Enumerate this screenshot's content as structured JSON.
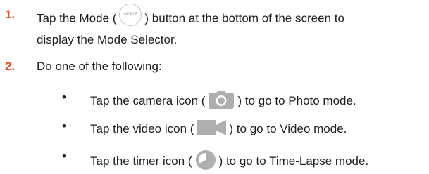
{
  "steps": [
    {
      "number": "1.",
      "line1_before": "Tap the Mode (",
      "line1_after": ") button at the bottom of the screen to",
      "line2": "display the Mode Selector.",
      "icon_label": "MODE"
    },
    {
      "number": "2.",
      "text": "Do one of the following:"
    }
  ],
  "options": [
    {
      "bullet": "•",
      "before": "Tap the camera icon (",
      "after": ") to go to Photo mode.",
      "icon": "camera-icon"
    },
    {
      "bullet": "•",
      "before": "Tap the video icon (",
      "after": ") to go to Video mode.",
      "icon": "video-icon"
    },
    {
      "bullet": "•",
      "before": "Tap the timer icon (",
      "after": ") to go to Time-Lapse mode.",
      "icon": "timer-icon"
    }
  ],
  "colors": {
    "step_number": "#d9532b",
    "text": "#1e1e1e",
    "icon_gray": "#aeaeae"
  }
}
